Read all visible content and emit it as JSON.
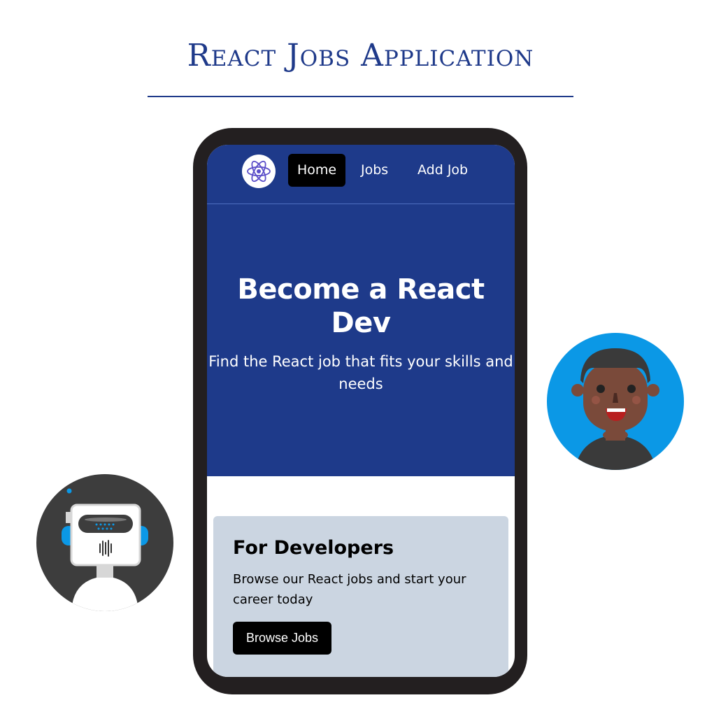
{
  "page": {
    "title": "React Jobs Application"
  },
  "navbar": {
    "logo_icon": "react-logo",
    "links": [
      {
        "label": "Home",
        "active": true
      },
      {
        "label": "Jobs",
        "active": false
      },
      {
        "label": "Add Job",
        "active": false
      }
    ]
  },
  "hero": {
    "title": "Become a React Dev",
    "subtitle": "Find the React job that fits your skills and needs"
  },
  "card": {
    "title": "For Developers",
    "text": "Browse our React jobs and start your career today",
    "button_label": "Browse Jobs"
  },
  "colors": {
    "primary": "#1e3a8a",
    "card_bg": "#cbd5e1",
    "accent_blue": "#0b98e6"
  },
  "illustrations": [
    "robot-avatar",
    "person-avatar"
  ]
}
